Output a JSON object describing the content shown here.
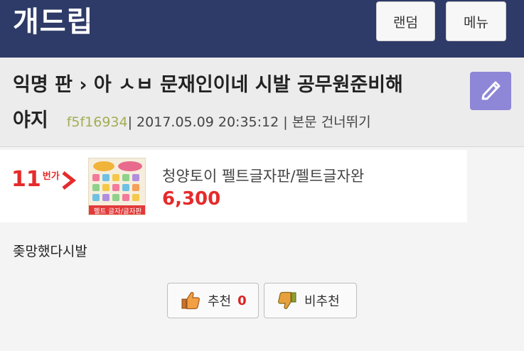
{
  "header": {
    "logo": "개드립",
    "random_label": "랜덤",
    "menu_label": "메뉴"
  },
  "post": {
    "title_line1": "익명 판 › 아 ㅅㅂ 문재인이네 시발 공무원준비해",
    "title_line2": "야지",
    "author": "f5f16934",
    "meta": " | 2017.05.09 20:35:12 | 본문 건너뛰기",
    "body": "좆망했다시발"
  },
  "ad": {
    "store_number": "11",
    "store_text": "번가",
    "thumbnail_caption": "펠트 글자/글자판",
    "product_title": "청양토이 펠트글자판/펠트글자완",
    "price": "6,300"
  },
  "votes": {
    "upvote_label": "추천",
    "upvote_count": "0",
    "downvote_label": "비추천"
  },
  "colors": {
    "header_bg": "#2e3a67",
    "accent_red": "#e52b2b",
    "author": "#a3ad54",
    "edit_button": "#8e86d6"
  },
  "icons": {
    "edit": "pencil-icon",
    "upvote": "thumbs-up-icon",
    "downvote": "thumbs-down-icon"
  }
}
